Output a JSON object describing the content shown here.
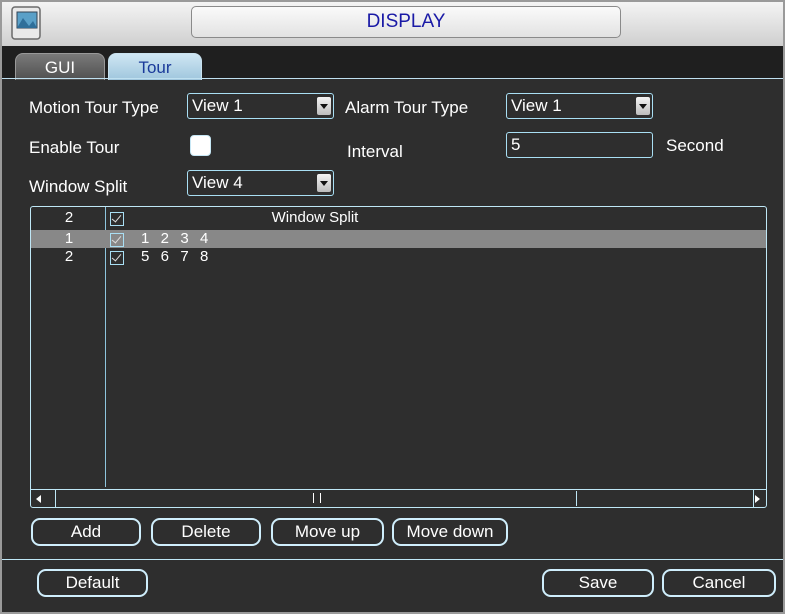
{
  "window": {
    "title": "DISPLAY",
    "icon": "display-app-icon"
  },
  "tabs": [
    {
      "label": "GUI",
      "active": false
    },
    {
      "label": "Tour",
      "active": true
    }
  ],
  "form": {
    "motion_tour_type_label": "Motion Tour Type",
    "motion_tour_type_value": "View 1",
    "alarm_tour_type_label": "Alarm Tour Type",
    "alarm_tour_type_value": "View 1",
    "enable_tour_label": "Enable Tour",
    "enable_tour_checked": false,
    "interval_label": "Interval",
    "interval_value": "5",
    "interval_unit": "Second",
    "window_split_label": "Window Split",
    "window_split_value": "View 4"
  },
  "table": {
    "header": {
      "count": "2",
      "checked": true,
      "title": "Window Split"
    },
    "rows": [
      {
        "index": "1",
        "checked": true,
        "channels": "1  2  3  4",
        "selected": true
      },
      {
        "index": "2",
        "checked": true,
        "channels": "5  6  7  8",
        "selected": false
      }
    ]
  },
  "actions": {
    "add": "Add",
    "delete": "Delete",
    "move_up": "Move up",
    "move_down": "Move down"
  },
  "footer": {
    "default": "Default",
    "save": "Save",
    "cancel": "Cancel"
  },
  "colors": {
    "accent": "#a9dff4",
    "title_text": "#1a1aa6",
    "background": "#2e2e2e",
    "selected_row": "#888888"
  }
}
